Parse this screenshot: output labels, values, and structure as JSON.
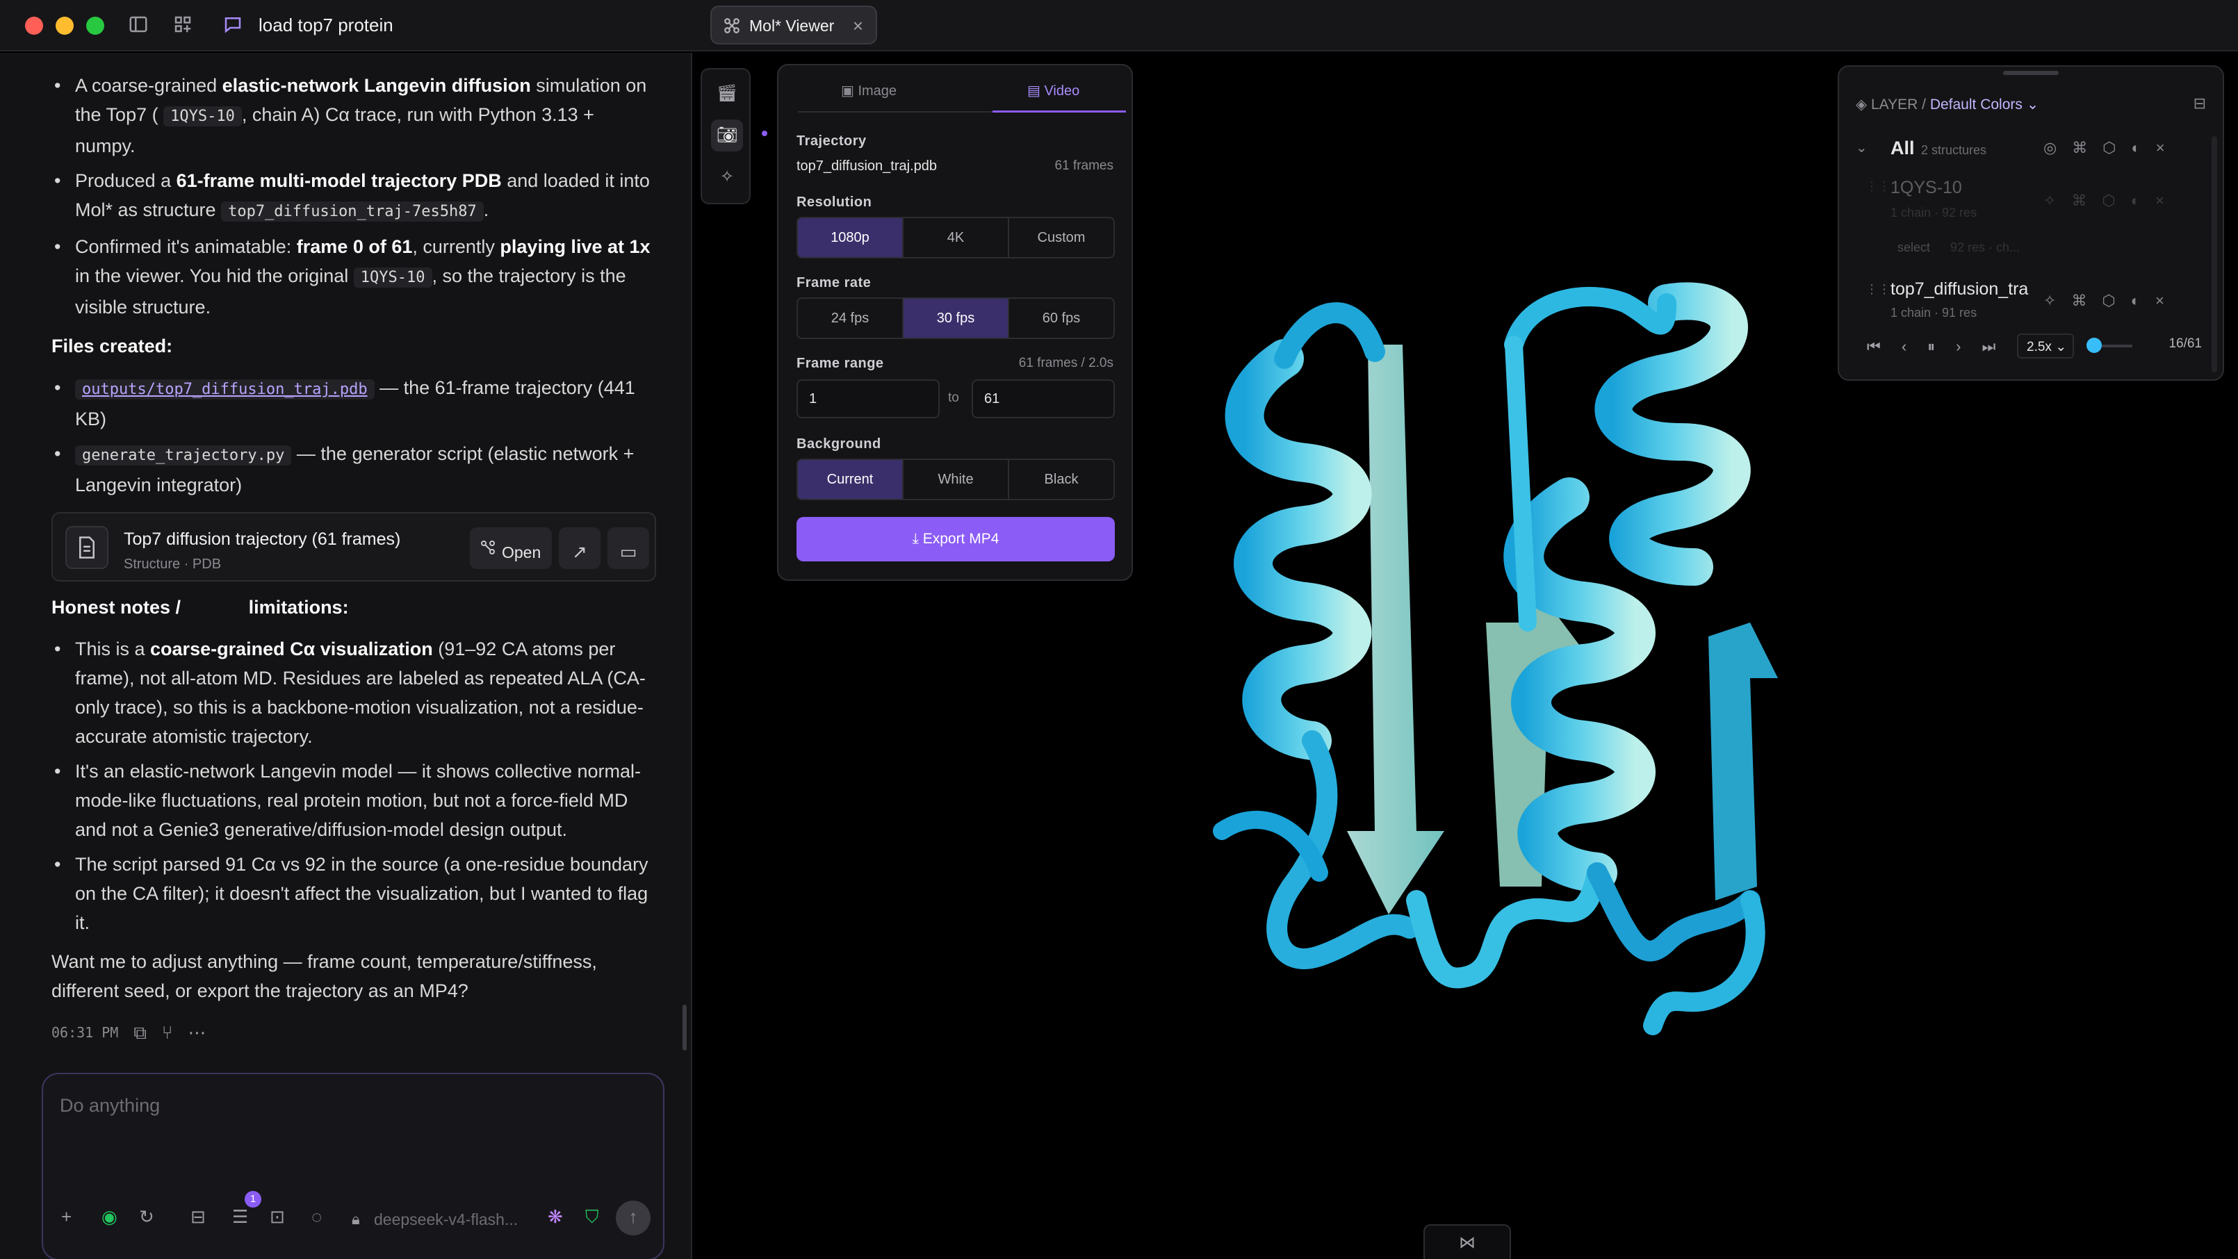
{
  "window": {
    "title": "load top7 protein",
    "traffic_lights": [
      "#ff5f57",
      "#febc2e",
      "#28c840"
    ],
    "tab_label": "Mol* Viewer"
  },
  "chat": {
    "bullets1": [
      {
        "pre": "A coarse-grained ",
        "b1": "elastic-network Langevin diffusion",
        "mid": " simulation on the Top7 (",
        "code": "1QYS-10",
        "post": ", chain A) Cα trace, run with Python 3.13 + numpy."
      },
      {
        "pre": "Produced a ",
        "b1": "61-frame multi-model trajectory PDB",
        "mid": " and loaded it into Mol* as structure ",
        "code": "top7_diffusion_traj-7es5h87",
        "post": "."
      },
      {
        "pre": "Confirmed it's animatable: ",
        "b1": "frame 0 of 61",
        "mid": ", currently ",
        "b2": "playing live at 1x",
        "mid2": " in the viewer. You hid the original ",
        "code": "1QYS-10",
        "post": ", so the trajectory is the visible structure."
      }
    ],
    "files_heading": "Files created:",
    "files": [
      {
        "name": "outputs/top7_diffusion_traj.pdb",
        "desc": " — the 61-frame trajectory (441 KB)"
      },
      {
        "name": "generate_trajectory.py",
        "desc": " — the generator script (elastic network + Langevin integrator)"
      }
    ],
    "file_card": {
      "title": "Top7 diffusion trajectory (61 frames)",
      "subtitle": "Structure · PDB",
      "open_label": "Open"
    },
    "notes_heading_a": "Honest notes /",
    "notes_heading_b": "limitations:",
    "notes": [
      {
        "pre": "This is a ",
        "b1": "coarse-grained Cα visualization",
        "post": " (91–92 CA atoms per frame), not all-atom MD. Residues are labeled as repeated ALA (CA-only trace), so this is a backbone-motion visualization, not a residue-accurate atomistic trajectory."
      },
      {
        "pre": "It's an elastic-network Langevin model — it shows collective normal-mode-like fluctuations, real protein motion, but not a force-field MD and not a Genie3 generative/diffusion-model design output.",
        "b1": "",
        "post": ""
      },
      {
        "pre": "The script parsed 91 Cα vs 92 in the source (a one-residue boundary on the CA filter); it doesn't affect the visualization, but I wanted to flag it.",
        "b1": "",
        "post": ""
      }
    ],
    "closing": "Want me to adjust anything — frame count, temperature/stiffness, different seed, or export the trajectory as an MP4?",
    "timestamp": "06:31 PM"
  },
  "composer": {
    "placeholder": "Do anything",
    "model": "deepseek-v4-flash...",
    "badge_count": "1"
  },
  "export_panel": {
    "tab_image": "Image",
    "tab_video": "Video",
    "trajectory_label": "Trajectory",
    "trajectory_file": "top7_diffusion_traj.pdb",
    "trajectory_frames": "61 frames",
    "resolution_label": "Resolution",
    "resolutions": [
      "1080p",
      "4K",
      "Custom"
    ],
    "framerate_label": "Frame rate",
    "framerates": [
      "24 fps",
      "30 fps",
      "60 fps"
    ],
    "framerange_label": "Frame range",
    "framerange_info": "61 frames / 2.0s",
    "range_from": "1",
    "range_to_word": "to",
    "range_to": "61",
    "background_label": "Background",
    "backgrounds": [
      "Current",
      "White",
      "Black"
    ],
    "export_label": "Export MP4"
  },
  "layer_panel": {
    "layer_word": "LAYER",
    "preset": "Default Colors",
    "all_label": "All",
    "all_count": "2 structures",
    "structures": [
      {
        "name": "1QYS-10",
        "sub": "1 chain · 92 res",
        "select_label": "select",
        "select_sub": "92 res · ch..."
      },
      {
        "name": "top7_diffusion_tra",
        "sub": "1 chain · 91 res"
      }
    ],
    "speed": "2.5x",
    "frame_counter": "16/61"
  },
  "colors": {
    "accent": "#8b5cf6",
    "ribbon_dark": "#1aa3d9",
    "ribbon_light": "#bdf0ea"
  }
}
